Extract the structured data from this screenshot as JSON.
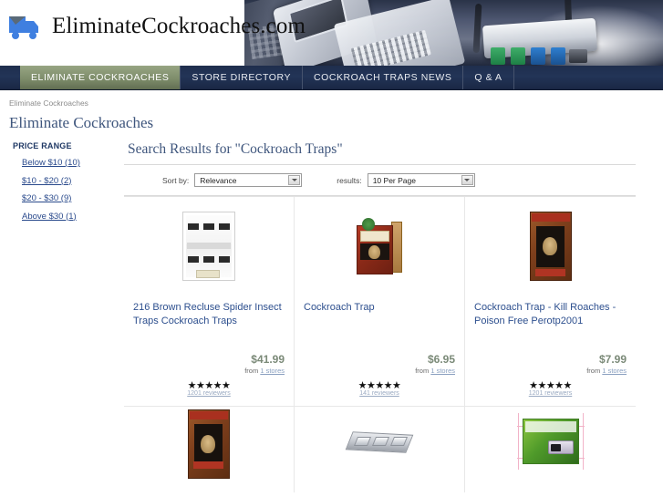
{
  "site": {
    "logo_text": "EliminateCockroaches.com",
    "logo_icon": "delivery-truck-icon",
    "banner_alt": "laptops-and-network-router-banner"
  },
  "nav": {
    "items": [
      {
        "label": "ELIMINATE COCKROACHES",
        "active": true
      },
      {
        "label": "STORE DIRECTORY",
        "active": false
      },
      {
        "label": "COCKROACH TRAPS NEWS",
        "active": false
      },
      {
        "label": "Q & A",
        "active": false
      }
    ]
  },
  "breadcrumb": {
    "text": "Eliminate Cockroaches"
  },
  "page": {
    "title": "Eliminate Cockroaches"
  },
  "sidebar": {
    "heading": "PRICE RANGE",
    "filters": [
      {
        "label": "Below $10 (10)"
      },
      {
        "label": "$10 - $20 (2)"
      },
      {
        "label": "$20 - $30 (9)"
      },
      {
        "label": "Above $30 (1)"
      }
    ]
  },
  "results": {
    "title": "Search Results for \"Cockroach Traps\"",
    "sort_label": "Sort by:",
    "sort_value": "Relevance",
    "results_label": "results:",
    "results_value": "10 Per Page"
  },
  "products": [
    {
      "title": "216 Brown Recluse Spider Insect Traps Cockroach Traps",
      "price": "$41.99",
      "from_text": "from",
      "stores": "1 stores",
      "stars": "★★★★★",
      "reviews": "1201 reviewers",
      "image": "glue-trap-sheet-package"
    },
    {
      "title": "Cockroach Trap",
      "price": "$6.95",
      "from_text": "from",
      "stores": "1 stores",
      "stars": "★★★★★",
      "reviews": "141 reviewers",
      "image": "red-cockroach-trap-box"
    },
    {
      "title": "Cockroach Trap - Kill Roaches - Poison Free Perotp2001",
      "price": "$7.99",
      "from_text": "from",
      "stores": "1 stores",
      "stars": "★★★★★",
      "reviews": "1201 reviewers",
      "image": "brown-cockroach-trap-box"
    }
  ],
  "products_row2": [
    {
      "image": "brown-cockroach-trap-box-2"
    },
    {
      "image": "metal-bait-station-tray"
    },
    {
      "image": "green-4pc-cockroach-traps-box"
    }
  ],
  "colors": {
    "nav_bg": "#223457",
    "nav_active": "#7e8d6b",
    "title_blue": "#3f567d",
    "link_blue": "#2d4f8e",
    "price_green": "#7b8a78",
    "sidebar_heading": "#1f3864"
  }
}
